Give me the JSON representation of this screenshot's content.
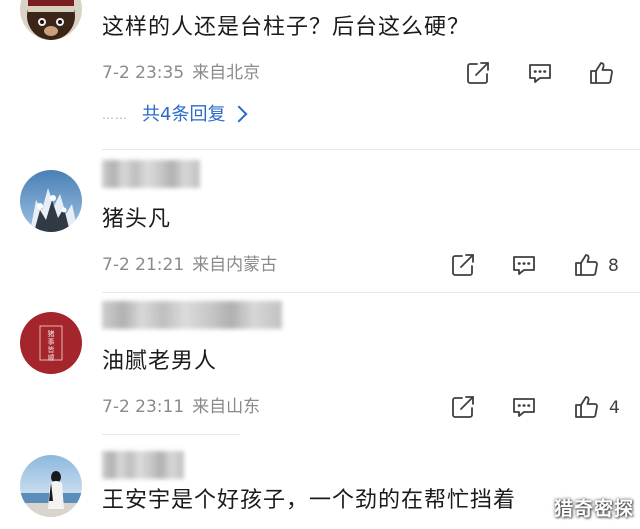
{
  "comments": [
    {
      "text": "这样的人还是台柱子？后台这么硬？",
      "date": "7-2 23:35",
      "location": "来自北京",
      "likes": "",
      "replies": {
        "dots": "……",
        "label": "共4条回复"
      },
      "avatar_icon": "bear-avatar-icon"
    },
    {
      "text": "猪头凡",
      "date": "7-2 21:21",
      "location": "来自内蒙古",
      "likes": "8",
      "avatar_icon": "snowy-tree-avatar-icon"
    },
    {
      "text": "油腻老男人",
      "date": "7-2 23:11",
      "location": "来自山东",
      "likes": "4",
      "avatar_icon": "red-seal-avatar-icon"
    },
    {
      "text": "王安宇是个好孩子，一个劲的在帮忙挡着",
      "avatar_icon": "figure-by-sea-avatar-icon"
    }
  ],
  "watermark": "猎奇密探",
  "avatar_seal_text": "猪事皆顺",
  "colors": {
    "link": "#2b6ac8",
    "meta": "#8a8a8a",
    "text": "#1b1b1b",
    "icon": "#3f3f3f",
    "seal_red": "#a4262c"
  },
  "icons": {
    "share": "share-icon",
    "reply": "reply-icon",
    "like": "thumbs-up-icon"
  }
}
